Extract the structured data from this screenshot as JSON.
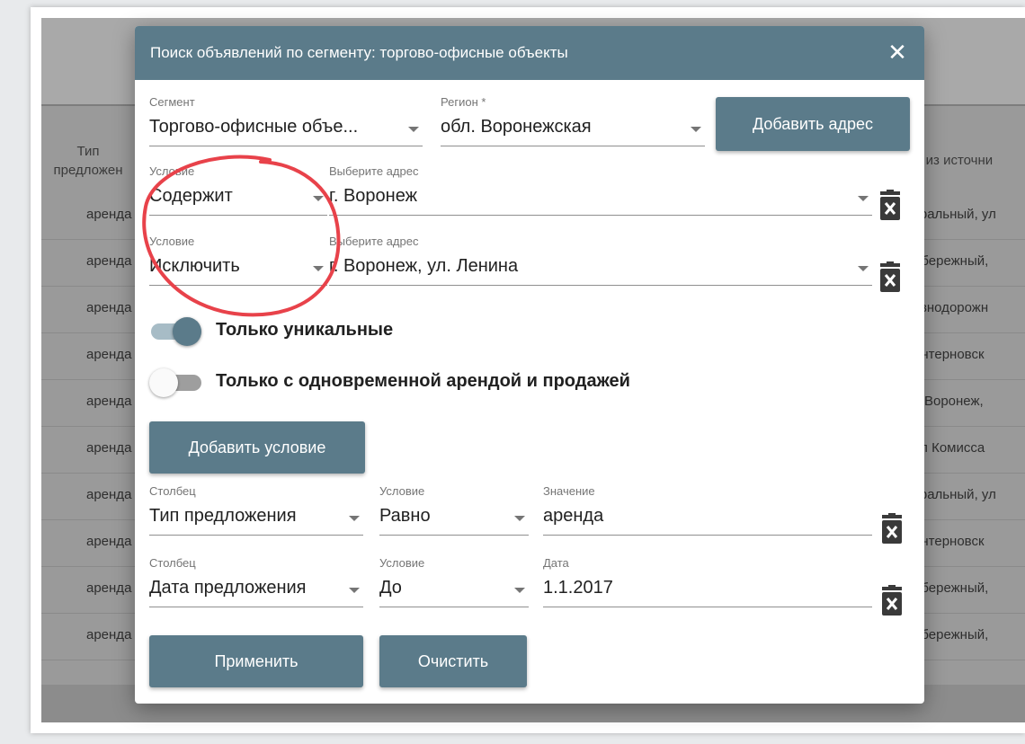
{
  "background": {
    "col_type_header": "Тип предложен",
    "col_source_header": "с из источни",
    "rows": [
      {
        "type": "аренда",
        "address": "тральный, ул"
      },
      {
        "type": "аренда",
        "address": "обережный,"
      },
      {
        "type": "аренда",
        "address": "езнодорожн"
      },
      {
        "type": "аренда",
        "address": "интерновск"
      },
      {
        "type": "аренда",
        "address": "г. Воронеж,"
      },
      {
        "type": "аренда",
        "address": "ул Комисса"
      },
      {
        "type": "аренда",
        "address": "тральный, ул"
      },
      {
        "type": "аренда",
        "address": "интерновск"
      },
      {
        "type": "аренда",
        "address": "обережный,"
      },
      {
        "type": "аренда",
        "address": "обережный,"
      }
    ]
  },
  "modal": {
    "title": "Поиск объявлений по сегменту: торгово-офисные объекты",
    "close_icon": "close-icon",
    "segment": {
      "label": "Сегмент",
      "value": "Торгово-офисные объе..."
    },
    "region": {
      "label": "Регион *",
      "value": "обл. Воронежская"
    },
    "add_address_label": "Добавить адрес",
    "address_conditions": [
      {
        "cond_label": "Условие",
        "cond_value": "Содержит",
        "addr_label": "Выберите адрес",
        "addr_value": "г. Воронеж"
      },
      {
        "cond_label": "Условие",
        "cond_value": "Исключить",
        "addr_label": "Выберите адрес",
        "addr_value": "г. Воронеж, ул. Ленина"
      }
    ],
    "toggles": [
      {
        "label": "Только уникальные",
        "on": true
      },
      {
        "label": "Только с одновременной арендой и продажей",
        "on": false
      }
    ],
    "add_condition_label": "Добавить условие",
    "filters": [
      {
        "col_label": "Столбец",
        "col_value": "Тип предложения",
        "cond_label": "Условие",
        "cond_value": "Равно",
        "val_label": "Значение",
        "val_value": "аренда"
      },
      {
        "col_label": "Столбец",
        "col_value": "Дата предложения",
        "cond_label": "Условие",
        "cond_value": "До",
        "val_label": "Дата",
        "val_value": "1.1.2017"
      }
    ],
    "apply_label": "Применить",
    "clear_label": "Очистить"
  },
  "colors": {
    "accent": "#5b7b8a",
    "annotation": "#e8424a"
  }
}
